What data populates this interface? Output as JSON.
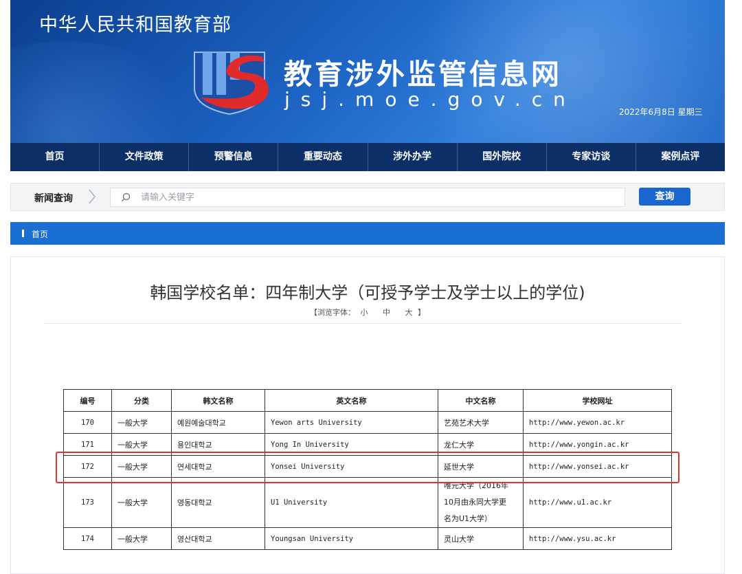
{
  "header": {
    "ministry": "中华人民共和国教育部",
    "site_title": "教育涉外监管信息网",
    "site_url": "jsj.moe.gov.cn",
    "date": "2022年6月8日 星期三",
    "brand_color": "#1d64c4"
  },
  "nav": {
    "items": [
      "首页",
      "文件政策",
      "预警信息",
      "重要动态",
      "涉外办学",
      "国外院校",
      "专家访谈",
      "案例点评"
    ]
  },
  "search": {
    "label": "新闻查询",
    "placeholder": "请输入关键字",
    "value": "",
    "button": "查询"
  },
  "breadcrumb": {
    "home": "首页"
  },
  "article": {
    "title": "韩国学校名单：四年制大学（可授予学士及学士以上的学位)",
    "font_prefix": "【浏览字体：",
    "font_small": "小",
    "font_medium": "中",
    "font_large": "大",
    "font_suffix": "】"
  },
  "table": {
    "headers": [
      "编号",
      "分类",
      "韩文名称",
      "英文名称",
      "中文名称",
      "学校网址"
    ],
    "rows": [
      [
        "170",
        "一般大学",
        "예원예술대학교",
        "Yewon arts University",
        "艺苑艺术大学",
        "http://www.yewon.ac.kr"
      ],
      [
        "171",
        "一般大学",
        "용인대학교",
        "Yong In University",
        "龙仁大学",
        "http://www.yongin.ac.kr"
      ],
      [
        "172",
        "一般大学",
        "연세대학교",
        "Yonsei University",
        "延世大学",
        "http://www.yonsei.ac.kr"
      ],
      [
        "173",
        "一般大学",
        "영동대학교",
        "U1 University",
        [
          "唯元大学（2016年",
          "10月由永同大学更",
          "名为U1大学）"
        ],
        "http://www.u1.ac.kr"
      ],
      [
        "174",
        "一般大学",
        "영산대학교",
        "Youngsan University",
        "灵山大学",
        "http://www.ysu.ac.kr"
      ]
    ]
  }
}
